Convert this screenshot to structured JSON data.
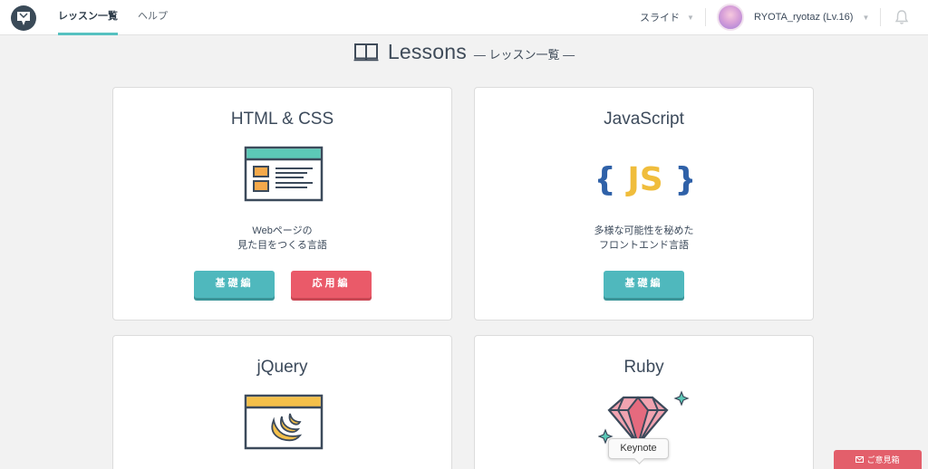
{
  "header": {
    "nav": [
      {
        "label": "レッスン一覧",
        "active": true
      },
      {
        "label": "ヘルプ",
        "active": false
      }
    ],
    "slide_menu": "スライド",
    "username": "RYOTA_ryotaz (Lv.16)"
  },
  "page": {
    "title": "Lessons",
    "subtitle": "— レッスン一覧 —"
  },
  "lessons": [
    {
      "title": "HTML & CSS",
      "desc_line1": "Webページの",
      "desc_line2": "見た目をつくる言語",
      "basic_label": "基礎編",
      "advanced_label": "応用編",
      "icon": "browser-window-icon"
    },
    {
      "title": "JavaScript",
      "desc_line1": "多様な可能性を秘めた",
      "desc_line2": "フロントエンド言語",
      "basic_label": "基礎編",
      "icon_text": "{ JS }",
      "icon": "js-braces-icon"
    },
    {
      "title": "jQuery",
      "icon": "jquery-window-icon"
    },
    {
      "title": "Ruby",
      "icon": "ruby-gem-icon"
    }
  ],
  "tooltip": "Keynote",
  "feedback_label": "ご意見箱",
  "colors": {
    "accent": "#56c1c0",
    "basic_button": "#4fb8bd",
    "advanced_button": "#ea5a69",
    "feedback": "#e35f6b"
  }
}
